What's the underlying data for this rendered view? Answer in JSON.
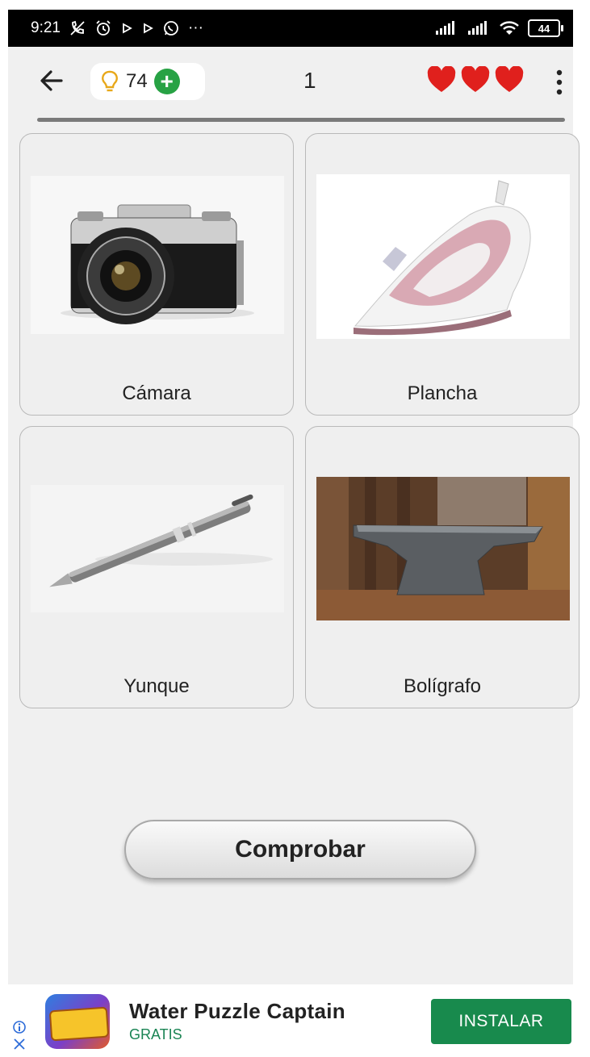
{
  "status_bar": {
    "time": "9:21",
    "icons": [
      "muted-call-icon",
      "alarm-icon",
      "play-icon",
      "play-icon",
      "whatsapp-icon",
      "more-dots-icon"
    ],
    "more": "···",
    "battery": "44"
  },
  "header": {
    "hint_count": "74",
    "level": "1",
    "lives": 3
  },
  "progress_fraction": 1,
  "cards": [
    {
      "label": "Cámara",
      "image": "camera"
    },
    {
      "label": "Plancha",
      "image": "iron"
    },
    {
      "label": "Yunque",
      "image": "pen"
    },
    {
      "label": "Bolígrafo",
      "image": "anvil"
    }
  ],
  "check_button": "Comprobar",
  "ad": {
    "title": "Water Puzzle Captain",
    "subtitle": "GRATIS",
    "cta": "INSTALAR",
    "icon_text": ""
  },
  "colors": {
    "heart": "#e0201d",
    "plus": "#27a244",
    "install": "#188a4d",
    "bulb": "#e8a81a"
  }
}
